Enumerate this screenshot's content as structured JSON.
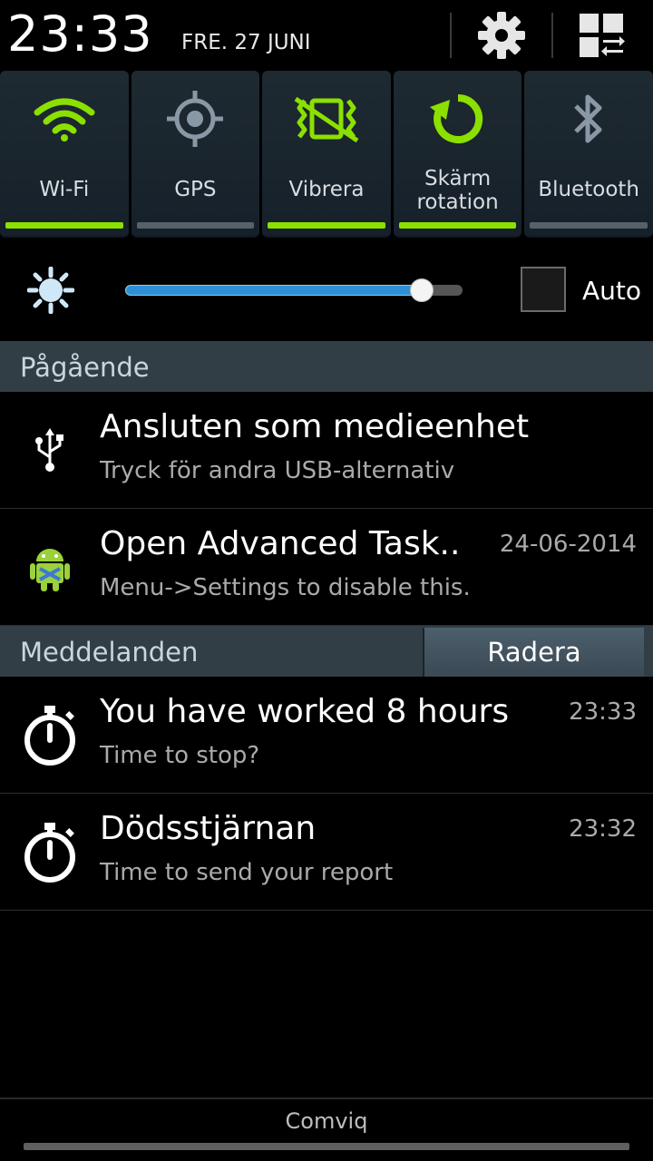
{
  "status": {
    "time": "23:33",
    "date": "FRE. 27 JUNI"
  },
  "toggles": [
    {
      "label": "Wi-Fi",
      "icon": "wifi-icon",
      "on": true
    },
    {
      "label": "GPS",
      "icon": "gps-icon",
      "on": false
    },
    {
      "label": "Vibrera",
      "icon": "vibrate-icon",
      "on": true
    },
    {
      "label": "Skärm rotation",
      "label_line1": "Skärm",
      "label_line2": "rotation",
      "icon": "rotation-icon",
      "on": true
    },
    {
      "label": "Bluetooth",
      "icon": "bluetooth-icon",
      "on": false
    }
  ],
  "brightness": {
    "level": 0.88,
    "auto_label": "Auto",
    "auto_checked": false
  },
  "ongoing": {
    "title": "Pågående",
    "items": [
      {
        "title": "Ansluten som medieenhet",
        "text": "Tryck för andra USB-alternativ",
        "time": "",
        "icon": "usb-icon"
      },
      {
        "title": "Open Advanced Task..",
        "text": "Menu->Settings to disable this.",
        "time": "24-06-2014",
        "icon": "android-icon"
      }
    ]
  },
  "notifications": {
    "title": "Meddelanden",
    "clear_label": "Radera",
    "items": [
      {
        "title": "You have worked 8 hours",
        "text": "Time to stop?",
        "time": "23:33",
        "icon": "stopwatch-icon"
      },
      {
        "title": "Dödsstjärnan",
        "text": "Time to send your report",
        "time": "23:32",
        "icon": "stopwatch-icon"
      }
    ]
  },
  "footer": {
    "carrier": "Comviq"
  },
  "colors": {
    "accent_on": "#8be000",
    "slider": "#2f8fd6",
    "section_bg": "#323e46"
  }
}
